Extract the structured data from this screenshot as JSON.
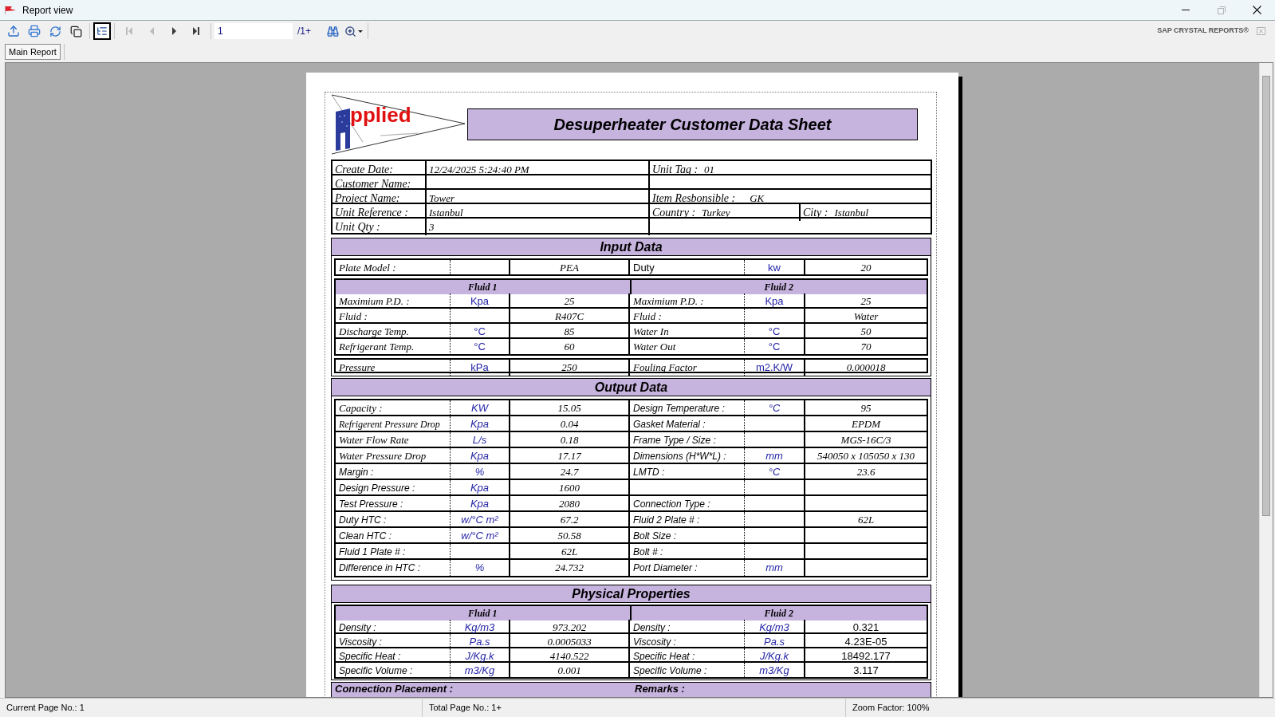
{
  "window": {
    "title": "Report view",
    "controls": [
      {
        "kind": "minimize",
        "disabled": false
      },
      {
        "kind": "maximize",
        "disabled": true
      },
      {
        "kind": "close",
        "disabled": false
      }
    ]
  },
  "toolbar": {
    "tree_toggle": {
      "on": true
    },
    "nav": [
      {
        "disabled": true
      },
      {
        "disabled": true
      },
      {
        "disabled": false
      },
      {
        "disabled": false
      }
    ],
    "page_field": {
      "value": "1"
    },
    "page_total": "/1+",
    "brand": "SAP CRYSTAL REPORTS®"
  },
  "tabs": [
    {
      "label": "Main Report",
      "selected": true
    }
  ],
  "report": {
    "logo": {
      "text": "pplied"
    },
    "title": "Desuperheater Customer Data Sheet",
    "info": {
      "rows": [
        {
          "label": "Create Date:",
          "value": "12/24/2025 5:24:40 PM",
          "right": [
            {
              "label": "Unit Tag :",
              "value": "01"
            }
          ]
        },
        {
          "label": "Customer Name:"
        },
        {
          "label": "Project Name:",
          "value": "Tower",
          "right": [
            {
              "label": "Item Resbonsible :",
              "value": "GK"
            }
          ]
        },
        {
          "label": "Unit Reference :",
          "value": "Istanbul",
          "right": [
            {
              "label": "Country :",
              "value": "Turkey"
            },
            {
              "label": "City :",
              "value": "Istanbul"
            }
          ]
        },
        {
          "label": "Unit Qty :",
          "value": "3"
        }
      ]
    },
    "input_data": {
      "title": "Input Data",
      "top_row": {
        "left": {
          "label": "Plate Model :",
          "value": "PEA"
        },
        "right": {
          "label": "Duty",
          "unit": "kw",
          "value": "20"
        }
      },
      "fluid_headers": [
        "Fluid 1",
        "Fluid 2"
      ],
      "rows": [
        {
          "left": {
            "label": "Maximium P.D. :",
            "unit": "Kpa",
            "value": "25"
          },
          "right": {
            "label": "Maximium P.D. :",
            "unit": "Kpa",
            "value": "25"
          }
        },
        {
          "left": {
            "label": "Fluid :",
            "value": "R407C"
          },
          "right": {
            "label": "Fluid :",
            "value": "Water"
          }
        },
        {
          "left": {
            "label": "Discharge Temp.",
            "unit": "°C",
            "value": "85"
          },
          "right": {
            "label": "Water In",
            "unit": "°C",
            "value": "50"
          }
        },
        {
          "left": {
            "label": "Refrigerant Temp.",
            "unit": "°C",
            "value": "60"
          },
          "right": {
            "label": "Water Out",
            "unit": "°C",
            "value": "70"
          }
        }
      ],
      "bottom_row": {
        "left": {
          "label": "Pressure",
          "unit": "kPa",
          "value": "250"
        },
        "right": {
          "label": "Fouling Factor",
          "unit": "m2.K/W",
          "value": "0.000018"
        }
      }
    },
    "output_data": {
      "title": "Output Data",
      "rows": [
        {
          "left": {
            "label": "Capacity :",
            "unit": "KW",
            "value": "15.05"
          },
          "right": {
            "label": "Design Temperature :",
            "unit": "°C",
            "value": "95"
          }
        },
        {
          "left": {
            "label": "Refrigerent Pressure Drop",
            "unit": "Kpa",
            "value": "0.04"
          },
          "right": {
            "label": "Gasket Material :",
            "value": "EPDM"
          }
        },
        {
          "left": {
            "label": "Water Flow Rate",
            "unit": "L/s",
            "value": "0.18"
          },
          "right": {
            "label": "Frame Type / Size :",
            "value": "MGS-16C/3"
          }
        },
        {
          "left": {
            "label": "Water Pressure Drop",
            "unit": "Kpa",
            "value": "17.17"
          },
          "right": {
            "label": "Dimensions (H*W*L) :",
            "unit": "mm",
            "value": "540050 x 105050 x 130"
          }
        },
        {
          "left": {
            "label": "Margin :",
            "unit": "%",
            "value": "24.7"
          },
          "right": {
            "label": "LMTD :",
            "unit": "°C",
            "value": "23.6"
          }
        },
        {
          "left": {
            "label": "Design Pressure :",
            "unit": "Kpa",
            "value": "1600"
          }
        },
        {
          "left": {
            "label": "Test Pressure :",
            "unit": "Kpa",
            "value": "2080"
          },
          "right": {
            "label": "Connection Type :"
          }
        },
        {
          "left": {
            "label": "Duty HTC :",
            "unit": "w/°C m²",
            "value": "67.2"
          },
          "right": {
            "label": "Fluid 2 Plate # :",
            "value": "62L"
          }
        },
        {
          "left": {
            "label": "Clean HTC :",
            "unit": "w/°C m²",
            "value": "50.58"
          },
          "right": {
            "label": "Bolt Size :"
          }
        },
        {
          "left": {
            "label": "Fluid 1 Plate # :",
            "value": "62L"
          },
          "right": {
            "label": "Bolt # :"
          }
        },
        {
          "left": {
            "label": "Difference in HTC :",
            "unit": "%",
            "value": "24.732"
          },
          "right": {
            "label": "Port Diameter :",
            "unit": "mm"
          }
        }
      ]
    },
    "physical_properties": {
      "title": "Physical Properties",
      "fluid_headers": [
        "Fluid 1",
        "Fluid 2"
      ],
      "rows": [
        {
          "left": {
            "label": "Density :",
            "unit": "Kg/m3",
            "value": "973.202"
          },
          "right": {
            "label": "Density :",
            "unit": "Kg/m3",
            "value": "0.321"
          }
        },
        {
          "left": {
            "label": "Viscosity :",
            "unit": "Pa.s",
            "value": "0.0005033"
          },
          "right": {
            "label": "Viscosity :",
            "unit": "Pa.s",
            "value": "4.23E-05"
          }
        },
        {
          "left": {
            "label": "Specific Heat :",
            "unit": "J/Kg.k",
            "value": "4140.522"
          },
          "right": {
            "label": "Specific Heat :",
            "unit": "J/Kg.k",
            "value": "18492.177"
          }
        },
        {
          "left": {
            "label": "Specific Volume :",
            "unit": "m3/Kg",
            "value": "0.001"
          },
          "right": {
            "label": "Specific Volume :",
            "unit": "m3/Kg",
            "value": "3.117"
          }
        }
      ]
    },
    "next_section": {
      "headers": [
        "Connection Placement :",
        "Remarks :"
      ]
    }
  },
  "status_bar": [
    "Current Page No.: 1",
    "Total Page No.: 1+",
    "Zoom Factor: 100%"
  ]
}
